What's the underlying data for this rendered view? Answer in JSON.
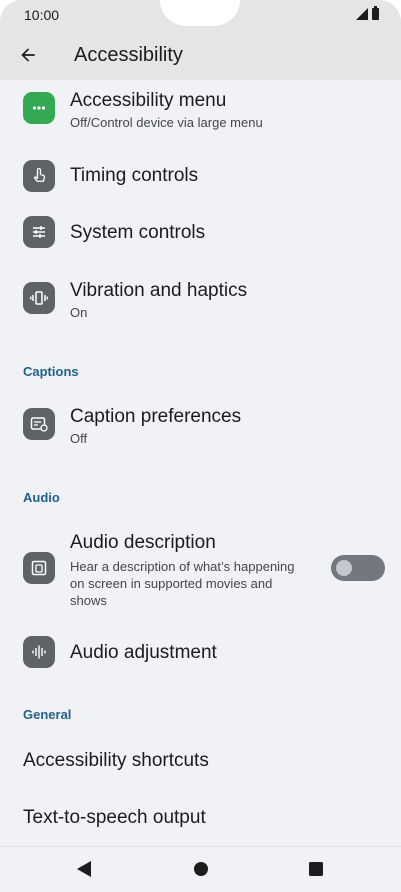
{
  "status_bar": {
    "time": "10:00"
  },
  "app_bar": {
    "title": "Accessibility"
  },
  "items": {
    "accessibility_menu": {
      "title": "Accessibility menu",
      "subtitle": "Off/Control device via large menu"
    },
    "timing_controls": {
      "title": "Timing controls"
    },
    "system_controls": {
      "title": "System controls"
    },
    "vibration": {
      "title": "Vibration and haptics",
      "subtitle": "On"
    },
    "caption_preferences": {
      "title": "Caption preferences",
      "subtitle": "Off"
    },
    "audio_description": {
      "title": "Audio description",
      "subtitle_line1": "Hear a description of what’s happening",
      "subtitle_line2": "on screen in supported movies and",
      "subtitle_line3": "shows",
      "toggle_on": false
    },
    "audio_adjustment": {
      "title": "Audio adjustment"
    },
    "accessibility_shortcuts": {
      "title": "Accessibility shortcuts"
    },
    "tts_output": {
      "title": "Text-to-speech output"
    }
  },
  "sections": {
    "captions": "Captions",
    "audio": "Audio",
    "general": "General"
  },
  "colors": {
    "accent_green": "#34a853",
    "section_header": "#22628c",
    "icon_gray": "#5f6368"
  }
}
